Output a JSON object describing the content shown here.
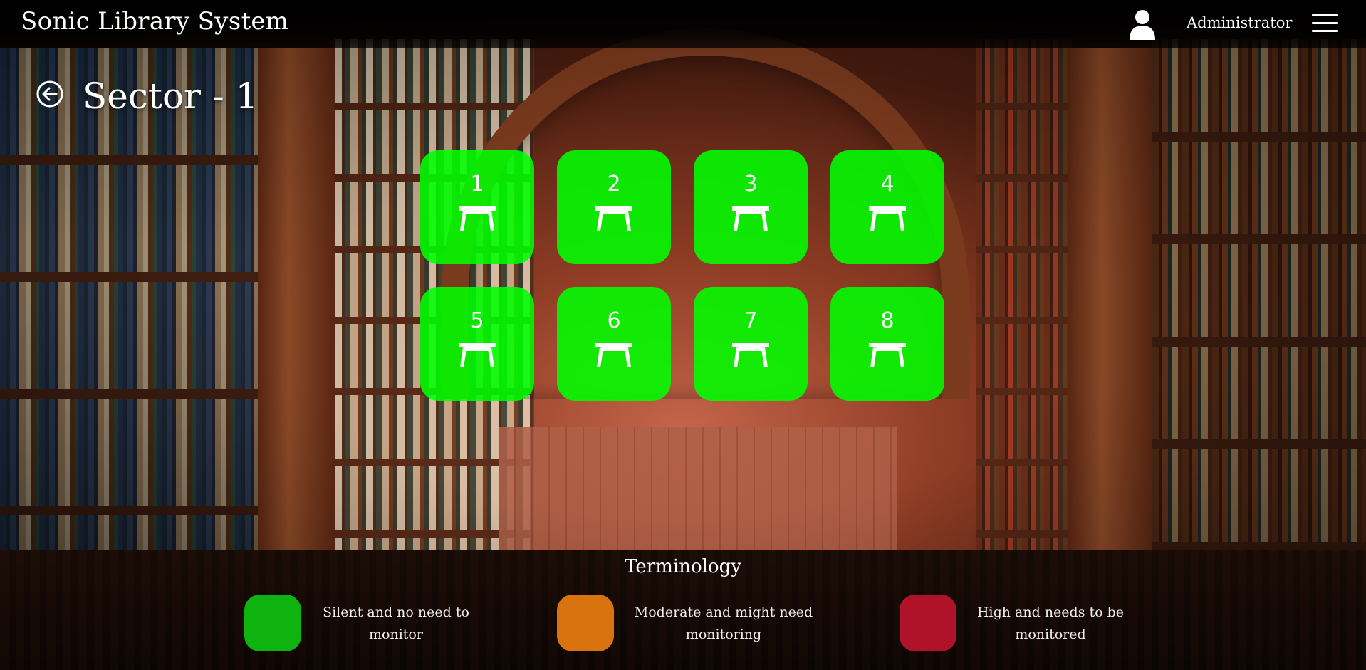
{
  "app": {
    "title": "Sonic Library System"
  },
  "header": {
    "user_name": "Administrator",
    "user_icon": "user-icon",
    "menu_icon": "hamburger-menu-icon"
  },
  "page": {
    "title": "Sector - 1",
    "back_icon": "back-arrow-circle-icon"
  },
  "desks": [
    {
      "label": "1",
      "status": "silent"
    },
    {
      "label": "2",
      "status": "silent"
    },
    {
      "label": "3",
      "status": "silent"
    },
    {
      "label": "4",
      "status": "silent"
    },
    {
      "label": "5",
      "status": "silent"
    },
    {
      "label": "6",
      "status": "silent"
    },
    {
      "label": "7",
      "status": "silent"
    },
    {
      "label": "8",
      "status": "silent"
    }
  ],
  "legend": {
    "title": "Terminology",
    "items": [
      {
        "text": "Silent and no need to monitor",
        "color": "#0fb30f"
      },
      {
        "text": "Moderate and might need monitoring",
        "color": "#d9730f"
      },
      {
        "text": "High and needs to be monitored",
        "color": "#b0122a"
      }
    ]
  },
  "colors": {
    "desk_silent": "#00ff00",
    "header_bg": "#000000"
  }
}
